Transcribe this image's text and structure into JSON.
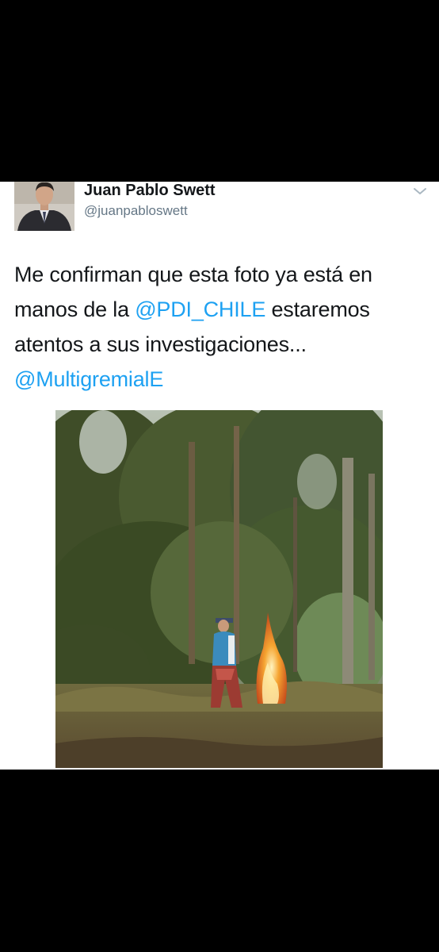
{
  "tweet": {
    "author_name": "Juan Pablo Swett",
    "author_handle": "@juanpabloswett",
    "text_part1": "Me confirman que esta foto ya está en manos de la ",
    "mention1": "@PDI_CHILE",
    "text_part2": " estaremos atentos a sus investigaciones...",
    "mention2": "@MultigremialE"
  },
  "icons": {
    "menu": "chevron-down-icon",
    "avatar": "avatar",
    "photo": "tweet-photo"
  },
  "colors": {
    "mention": "#1da1f2",
    "name": "#14171a",
    "handle": "#657786"
  }
}
